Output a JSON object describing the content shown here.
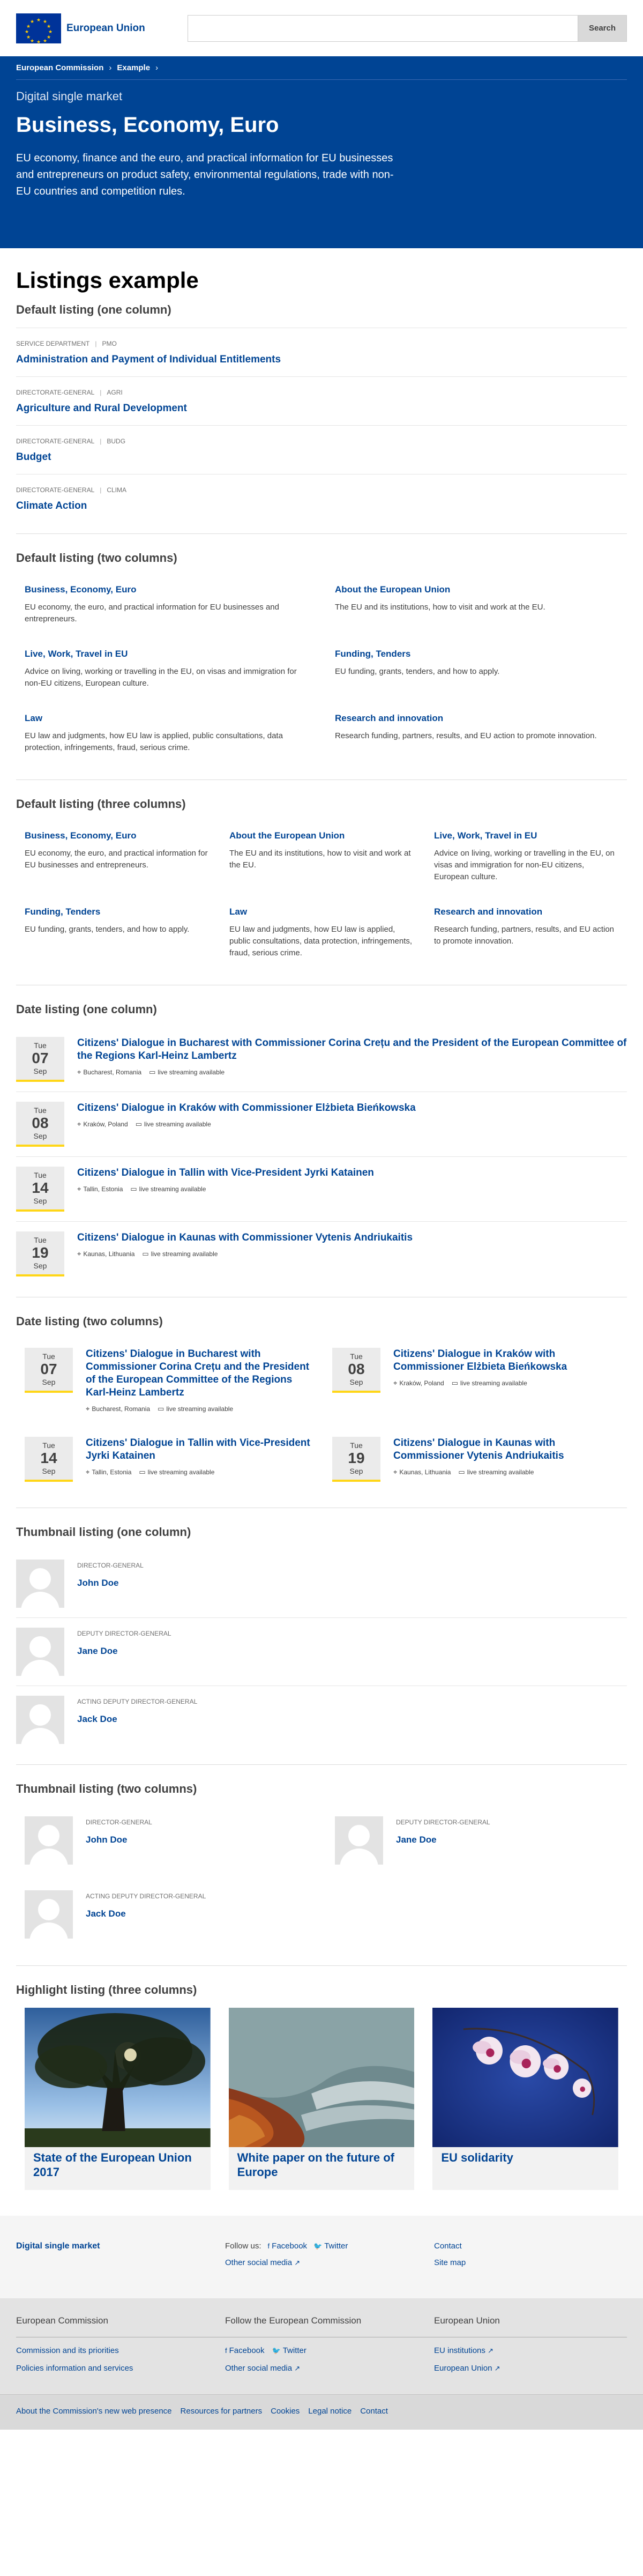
{
  "header": {
    "logo_text": "European Union",
    "search_placeholder": "",
    "search_button": "Search"
  },
  "breadcrumb": [
    "European Commission",
    "Example"
  ],
  "hero": {
    "meta": "Digital single market",
    "title": "Business, Economy, Euro",
    "intro": "EU economy, finance and the euro, and practical information for EU businesses and entrepreneurs on product safety, environmental regulations, trade with non-EU countries and competition rules."
  },
  "page_title": "Listings example",
  "default_one": {
    "title": "Default listing (one column)",
    "items": [
      {
        "type": "SERVICE DEPARTMENT",
        "code": "PMO",
        "label": "Administration and Payment of Individual Entitlements"
      },
      {
        "type": "DIRECTORATE-GENERAL",
        "code": "AGRI",
        "label": "Agriculture and Rural Development"
      },
      {
        "type": "DIRECTORATE-GENERAL",
        "code": "BUDG",
        "label": "Budget"
      },
      {
        "type": "DIRECTORATE-GENERAL",
        "code": "CLIMA",
        "label": "Climate Action"
      }
    ]
  },
  "default_two": {
    "title": "Default listing (two columns)",
    "items": [
      {
        "title": "Business, Economy, Euro",
        "text": "EU economy, the euro, and practical information for EU businesses and entrepreneurs."
      },
      {
        "title": "About the European Union",
        "text": "The EU and its institutions, how to visit and work at the EU."
      },
      {
        "title": "Live, Work, Travel in EU",
        "text": "Advice on living, working or travelling in the EU, on visas and immigration for non-EU citizens, European culture."
      },
      {
        "title": "Funding, Tenders",
        "text": "EU funding, grants, tenders, and how to apply."
      },
      {
        "title": "Law",
        "text": "EU law and judgments, how EU law is applied, public consultations, data protection, infringements, fraud, serious crime."
      },
      {
        "title": "Research and innovation",
        "text": "Research funding, partners, results, and EU action to promote innovation."
      }
    ]
  },
  "default_three": {
    "title": "Default listing (three columns)",
    "items": [
      {
        "title": "Business, Economy, Euro",
        "text": "EU economy, the euro, and practical information for EU businesses and entrepreneurs."
      },
      {
        "title": "About the European Union",
        "text": "The EU and its institutions, how to visit and work at the EU."
      },
      {
        "title": "Live, Work, Travel in EU",
        "text": "Advice on living, working or travelling in the EU, on visas and immigration for non-EU citizens, European culture."
      },
      {
        "title": "Funding, Tenders",
        "text": "EU funding, grants, tenders, and how to apply."
      },
      {
        "title": "Law",
        "text": "EU law and judgments, how EU law is applied, public consultations, data protection, infringements, fraud, serious crime."
      },
      {
        "title": "Research and innovation",
        "text": "Research funding, partners, results, and EU action to promote innovation."
      }
    ]
  },
  "date_one": {
    "title": "Date listing (one column)",
    "items": [
      {
        "weekday": "Tue",
        "day": "07",
        "month": "Sep",
        "title": "Citizens' Dialogue in Bucharest with Commissioner Corina Crețu and the President of the European Committee of the Regions Karl-Heinz Lambertz",
        "location": "Bucharest, Romania",
        "stream": "live streaming available"
      },
      {
        "weekday": "Tue",
        "day": "08",
        "month": "Sep",
        "title": "Citizens' Dialogue in Kraków with Commissioner Elżbieta Bieńkowska",
        "location": "Kraków, Poland",
        "stream": "live streaming available"
      },
      {
        "weekday": "Tue",
        "day": "14",
        "month": "Sep",
        "title": "Citizens' Dialogue in Tallin with Vice-President Jyrki Katainen",
        "location": "Tallin, Estonia",
        "stream": "live streaming available"
      },
      {
        "weekday": "Tue",
        "day": "19",
        "month": "Sep",
        "title": "Citizens' Dialogue in Kaunas with Commissioner Vytenis Andriukaitis",
        "location": "Kaunas, Lithuania",
        "stream": "live streaming available"
      }
    ]
  },
  "date_two": {
    "title": "Date listing (two columns)"
  },
  "thumb_one": {
    "title": "Thumbnail listing (one column)",
    "items": [
      {
        "role": "DIRECTOR-GENERAL",
        "name": "John Doe"
      },
      {
        "role": "DEPUTY DIRECTOR-GENERAL",
        "name": "Jane Doe"
      },
      {
        "role": "ACTING DEPUTY DIRECTOR-GENERAL",
        "name": "Jack Doe"
      }
    ]
  },
  "thumb_two": {
    "title": "Thumbnail listing (two columns)"
  },
  "highlight": {
    "title": "Highlight listing (three columns)",
    "items": [
      {
        "title": "State of the European Union 2017"
      },
      {
        "title": "White paper on the future of Europe"
      },
      {
        "title": "EU solidarity"
      }
    ]
  },
  "footer_site": {
    "site_name": "Digital single market",
    "follow_label": "Follow us:",
    "facebook": "Facebook",
    "twitter": "Twitter",
    "other_social": "Other social media",
    "contact": "Contact",
    "site_map": "Site map"
  },
  "footer_corp": {
    "col1_title": "European Commission",
    "col1_links": [
      "Commission and its priorities",
      "Policies information and services"
    ],
    "col2_title": "Follow the European Commission",
    "col2_facebook": "Facebook",
    "col2_twitter": "Twitter",
    "col2_other": "Other social media",
    "col3_title": "European Union",
    "col3_links": [
      "EU institutions",
      "European Union"
    ]
  },
  "footer_bottom": [
    "About the Commission's new web presence",
    "Resources for partners",
    "Cookies",
    "Legal notice",
    "Contact"
  ],
  "colors": {
    "primary": "#004494",
    "accent": "#ffd617"
  }
}
